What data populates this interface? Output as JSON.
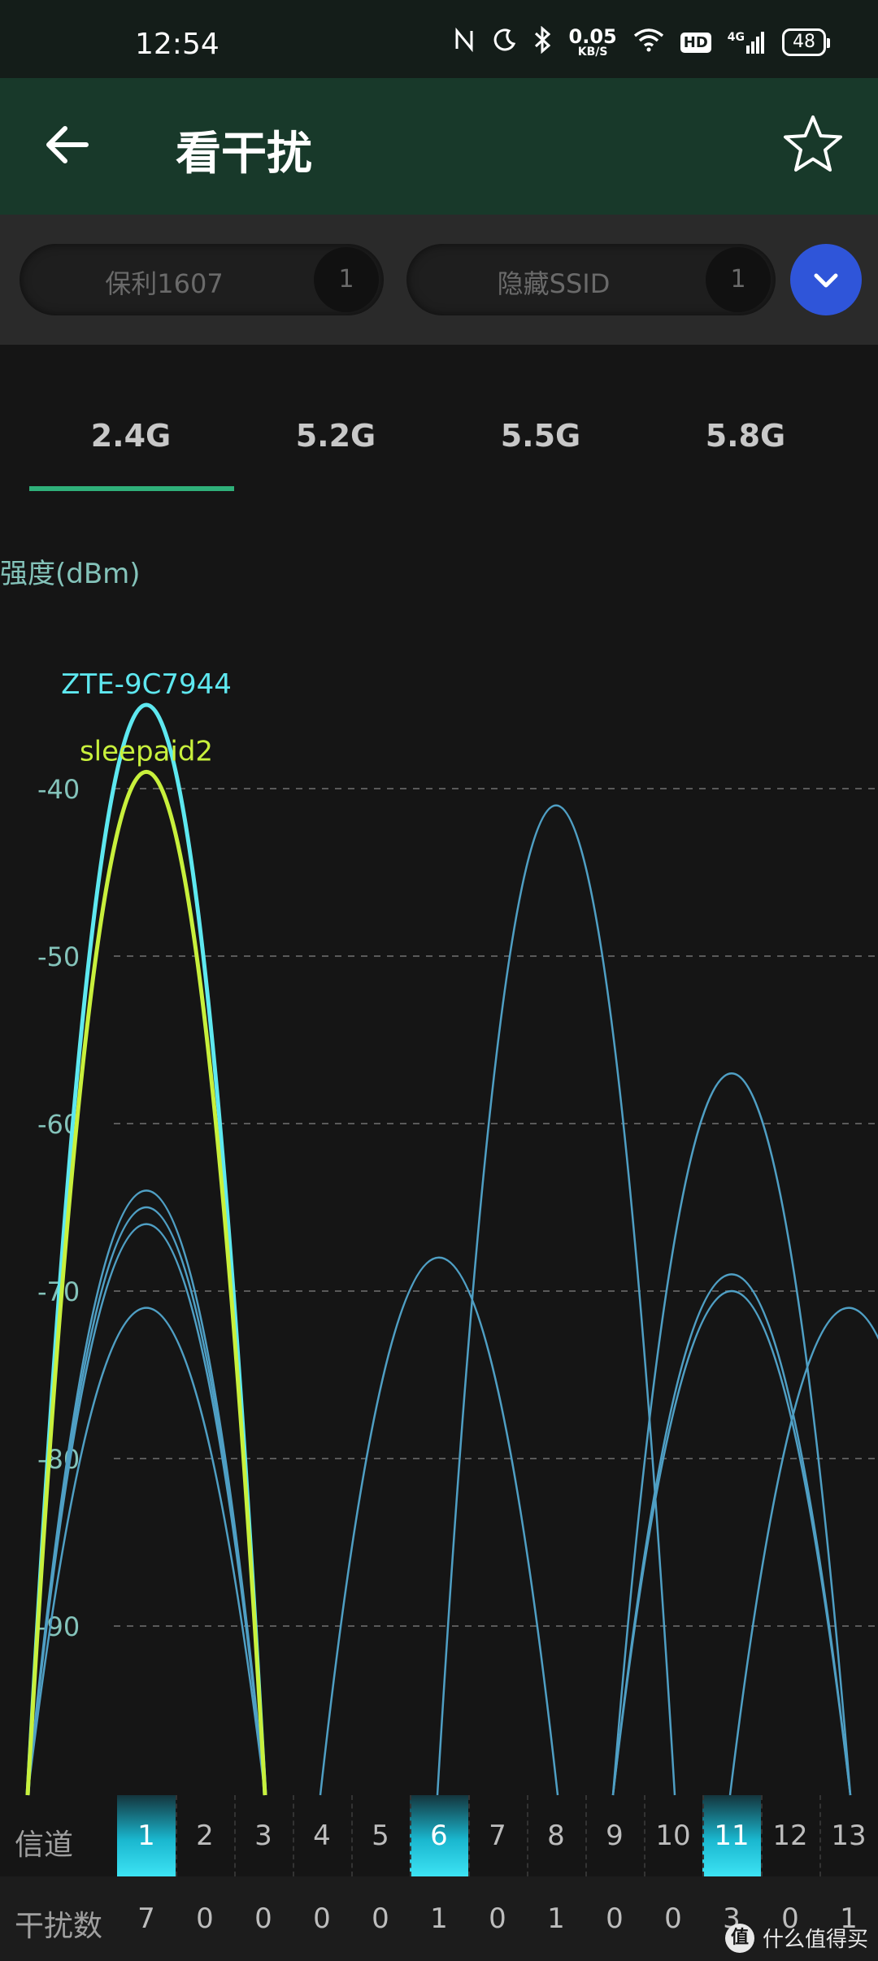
{
  "status_bar": {
    "time": "12:54",
    "speed_value": "0.05",
    "speed_unit": "KB/S",
    "hd_badge": "HD",
    "network": "4G",
    "battery": "48"
  },
  "app_bar": {
    "title": "看干扰"
  },
  "filters": [
    {
      "label": "保利1607",
      "count": "1"
    },
    {
      "label": "隐藏SSID",
      "count": "1"
    }
  ],
  "bands": [
    "2.4G",
    "5.2G",
    "5.5G",
    "5.8G"
  ],
  "selected_band": "2.4G",
  "axis": {
    "y_label": "强度(dBm)"
  },
  "chart_data": {
    "type": "line",
    "ylabel": "强度(dBm)",
    "xlabel": "信道",
    "ylim": [
      -100,
      -34
    ],
    "y_ticks": [
      -40,
      -50,
      -60,
      -70,
      -80,
      -90
    ],
    "x_ticks": [
      1,
      2,
      3,
      4,
      5,
      6,
      7,
      8,
      9,
      10,
      11,
      12,
      13
    ],
    "grid": "horizontal dashed",
    "series": [
      {
        "name": "ZTE-9C7944",
        "center_channel": 1,
        "peak_dbm": -35,
        "color": "#5ee8f0",
        "highlighted": true
      },
      {
        "name": "sleepaid2",
        "center_channel": 1,
        "peak_dbm": -39,
        "color": "#c8f03c",
        "highlighted": true
      },
      {
        "name": "",
        "center_channel": 1,
        "peak_dbm": -64,
        "color": "#4f9fc4"
      },
      {
        "name": "",
        "center_channel": 1,
        "peak_dbm": -65,
        "color": "#4f9fc4"
      },
      {
        "name": "",
        "center_channel": 1,
        "peak_dbm": -66,
        "color": "#4f9fc4"
      },
      {
        "name": "",
        "center_channel": 1,
        "peak_dbm": -71,
        "color": "#4f9fc4"
      },
      {
        "name": "",
        "center_channel": 6,
        "peak_dbm": -68,
        "color": "#4f9fc4"
      },
      {
        "name": "",
        "center_channel": 8,
        "peak_dbm": -41,
        "color": "#4f9fc4"
      },
      {
        "name": "",
        "center_channel": 11,
        "peak_dbm": -57,
        "color": "#4f9fc4"
      },
      {
        "name": "",
        "center_channel": 11,
        "peak_dbm": -69,
        "color": "#4f9fc4"
      },
      {
        "name": "",
        "center_channel": 11,
        "peak_dbm": -70,
        "color": "#4f9fc4"
      },
      {
        "name": "",
        "center_channel": 13,
        "peak_dbm": -71,
        "color": "#4f9fc4"
      }
    ]
  },
  "channel_row": {
    "label": "信道",
    "channels": [
      "1",
      "2",
      "3",
      "4",
      "5",
      "6",
      "7",
      "8",
      "9",
      "10",
      "11",
      "12",
      "13"
    ],
    "highlighted": [
      "1",
      "6",
      "11"
    ]
  },
  "interference_row": {
    "label": "干扰数",
    "counts": [
      "7",
      "0",
      "0",
      "0",
      "0",
      "1",
      "0",
      "1",
      "0",
      "0",
      "3",
      "0",
      "1"
    ]
  },
  "watermark": {
    "badge": "值",
    "text": "什么值得买"
  }
}
